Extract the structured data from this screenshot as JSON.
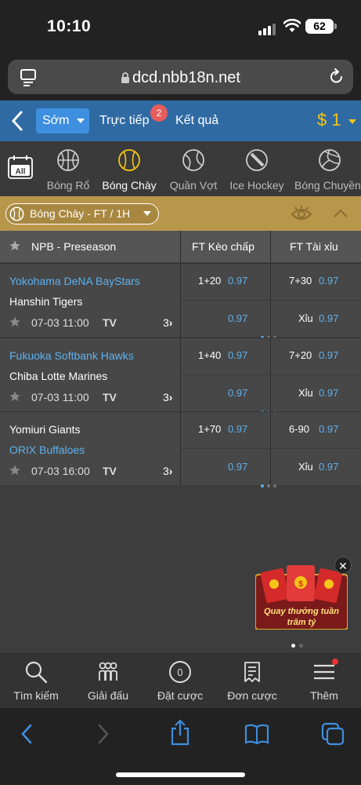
{
  "status_bar": {
    "time": "10:10",
    "battery": "62"
  },
  "browser": {
    "url": "dcd.nbb18n.net"
  },
  "top_nav": {
    "early_label": "Sớm",
    "live_label": "Trực tiếp",
    "live_badge": "2",
    "results_label": "Kết quả",
    "balance": "$ 1"
  },
  "sports_tabs": [
    {
      "label": "All",
      "icon": "calendar-all-icon",
      "active": false
    },
    {
      "label": "Bóng Rổ",
      "icon": "basketball-icon",
      "active": false
    },
    {
      "label": "Bóng Chày",
      "icon": "baseball-icon",
      "active": true
    },
    {
      "label": "Quần Vợt",
      "icon": "tennis-icon",
      "active": false
    },
    {
      "label": "Ice Hockey",
      "icon": "hockey-puck-icon",
      "active": false
    },
    {
      "label": "Bóng Chuyền",
      "icon": "volleyball-icon",
      "active": false
    }
  ],
  "filter": {
    "label": "Bóng Chày - FT / 1H"
  },
  "table": {
    "league": "NPB - Preseason",
    "col_handicap": "FT Kèo chấp",
    "col_overunder": "FT Tài xỉu"
  },
  "matches": [
    {
      "home": "Yokohama DeNA BayStars",
      "away": "Hanshin Tigers",
      "fav": "home",
      "date": "07-03 11:00",
      "tv": "TV",
      "more": "3",
      "hcap_line": "1+20",
      "hcap_home": "0.97",
      "hcap_away": "0.97",
      "ou_line": "7+30",
      "ou_over": "0.97",
      "ou_under_label": "Xỉu",
      "ou_under": "0.97"
    },
    {
      "home": "Fukuoka Softbank Hawks",
      "away": "Chiba Lotte Marines",
      "fav": "home",
      "date": "07-03 11:00",
      "tv": "TV",
      "more": "3",
      "hcap_line": "1+40",
      "hcap_home": "0.97",
      "hcap_away": "0.97",
      "ou_line": "7+20",
      "ou_over": "0.97",
      "ou_under_label": "Xỉu",
      "ou_under": "0.97"
    },
    {
      "home": "Yomiuri Giants",
      "away": "ORIX Buffaloes",
      "fav": "away",
      "date": "07-03 16:00",
      "tv": "TV",
      "more": "3",
      "hcap_line": "1+70",
      "hcap_home": "0.97",
      "hcap_away": "0.97",
      "ou_line": "6-90",
      "ou_over": "0.97",
      "ou_under_label": "Xỉu",
      "ou_under": "0.97"
    }
  ],
  "promo": {
    "text": "Quay thưởng tuần trăm tỷ"
  },
  "bottom_nav": [
    {
      "label": "Tìm kiếm",
      "icon": "search-icon"
    },
    {
      "label": "Giải đấu",
      "icon": "leagues-icon"
    },
    {
      "label": "Đặt cược",
      "icon": "bet-slip-icon",
      "count": "0"
    },
    {
      "label": "Đơn cược",
      "icon": "orders-icon"
    },
    {
      "label": "Thêm",
      "icon": "menu-icon"
    }
  ],
  "colors": {
    "nav_blue": "#2f6aa3",
    "accent_blue": "#5db1ee",
    "gold": "#b8964a",
    "balance_yellow": "#f5c518"
  }
}
